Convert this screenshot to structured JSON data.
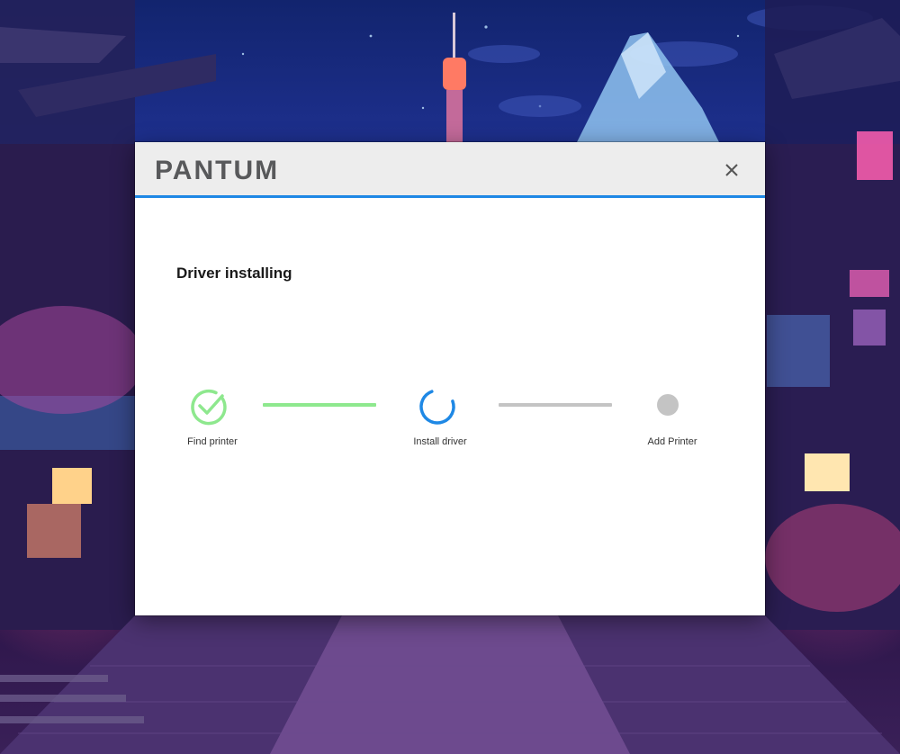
{
  "window": {
    "brand": "PANTUM",
    "close_icon": "close-icon"
  },
  "main": {
    "heading": "Driver installing"
  },
  "steps": [
    {
      "label": "Find printer",
      "state": "complete",
      "icon": "checkmark-circle-icon"
    },
    {
      "label": "Install driver",
      "state": "in-progress",
      "icon": "spinner-icon"
    },
    {
      "label": "Add Printer",
      "state": "pending",
      "icon": "pending-dot-icon"
    }
  ],
  "connectors": [
    {
      "state": "complete"
    },
    {
      "state": "pending"
    }
  ],
  "colors": {
    "accent_blue": "#1e88e5",
    "complete_green": "#8ee88e",
    "pending_gray": "#c4c4c4",
    "titlebar_bg": "#ededed",
    "logo_gray": "#58595b"
  }
}
